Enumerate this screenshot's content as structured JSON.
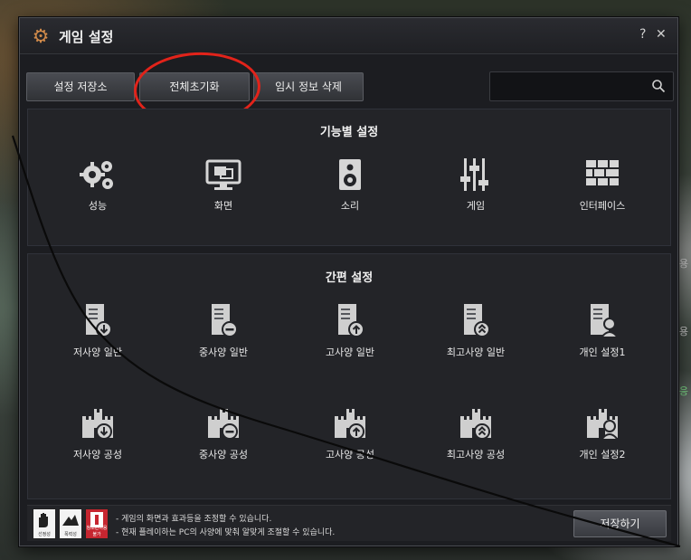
{
  "window": {
    "title": "게임 설정",
    "help": "?",
    "close": "✕"
  },
  "toolbar": {
    "save_storage": "설정 저장소",
    "reset_all": "전체초기화",
    "delete_temp": "임시 정보 삭제",
    "search_placeholder": ""
  },
  "function_settings": {
    "title": "기능별 설정",
    "items": [
      {
        "label": "성능",
        "icon": "gears-icon"
      },
      {
        "label": "화면",
        "icon": "monitor-icon"
      },
      {
        "label": "소리",
        "icon": "speaker-icon"
      },
      {
        "label": "게임",
        "icon": "sliders-icon"
      },
      {
        "label": "인터페이스",
        "icon": "interface-icon"
      }
    ]
  },
  "quick_settings": {
    "title": "간편 설정",
    "row1": [
      {
        "label": "저사양 일반",
        "icon": "server-down-icon"
      },
      {
        "label": "중사양 일반",
        "icon": "server-minus-icon"
      },
      {
        "label": "고사양 일반",
        "icon": "server-up-icon"
      },
      {
        "label": "최고사양 일반",
        "icon": "server-double-up-icon"
      },
      {
        "label": "개인 설정1",
        "icon": "server-person-icon"
      }
    ],
    "row2": [
      {
        "label": "저사양 공성",
        "icon": "castle-down-icon"
      },
      {
        "label": "중사양 공성",
        "icon": "castle-minus-icon"
      },
      {
        "label": "고사양 공성",
        "icon": "castle-up-icon"
      },
      {
        "label": "최고사양 공성",
        "icon": "castle-double-up-icon"
      },
      {
        "label": "개인 설정2",
        "icon": "castle-person-icon"
      }
    ]
  },
  "footer": {
    "ratings": [
      "선정성",
      "폭력성",
      "청소년이용불가"
    ],
    "notice_lines": [
      "- 게임의 화면과 효과등을 조정할 수 있습니다.",
      "- 현재 플레이하는 PC의 사양에 맞춰 알맞게 조절할 수 있습니다."
    ],
    "confirm": "저장하기"
  },
  "background": {
    "side_text": [
      "용",
      "용",
      "응"
    ]
  },
  "colors": {
    "accent_icon": "#d08a4a",
    "highlight_ellipse": "#e2231a",
    "window_bg": "#1c1d21"
  }
}
